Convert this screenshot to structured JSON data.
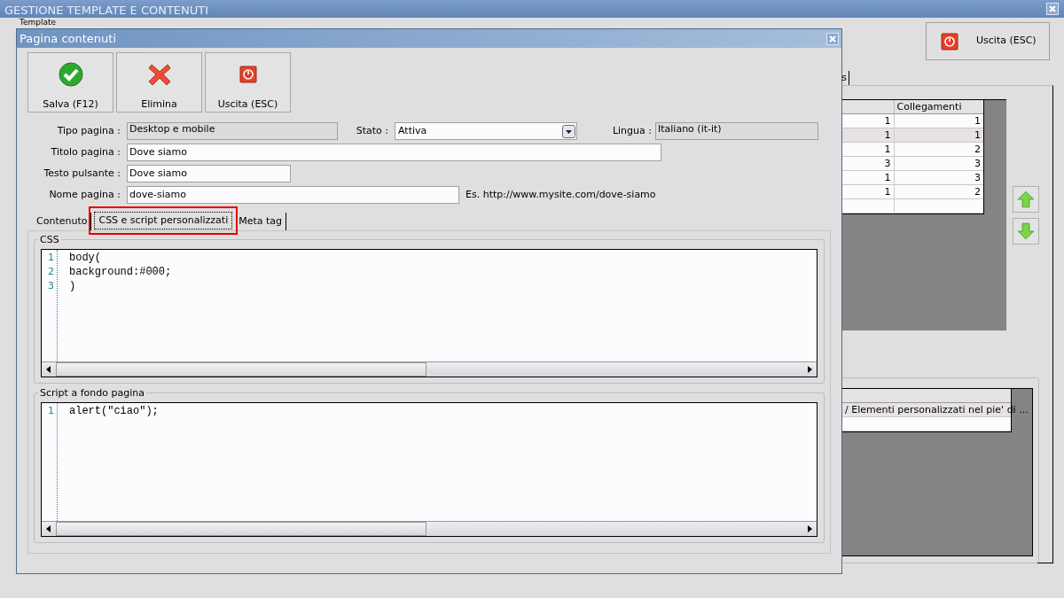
{
  "main_window": {
    "title": "GESTIONE TEMPLATE E CONTENUTI",
    "group_label": "Template",
    "exit_button": "Uscita (ESC)",
    "tab_fragment": "s",
    "links_table": {
      "columns": [
        "",
        "Collegamenti"
      ],
      "rows": [
        {
          "cells": [
            "1",
            "1"
          ],
          "selected": false
        },
        {
          "cells": [
            "1",
            "1"
          ],
          "selected": true
        },
        {
          "cells": [
            "1",
            "2"
          ],
          "selected": false
        },
        {
          "cells": [
            "3",
            "3"
          ],
          "selected": false
        },
        {
          "cells": [
            "1",
            "3"
          ],
          "selected": false
        },
        {
          "cells": [
            "1",
            "2"
          ],
          "selected": false
        },
        {
          "cells": [
            "",
            ""
          ],
          "selected": false
        }
      ]
    },
    "footer_table": {
      "rows": [
        "/ Elementi personalizzati nel pie' di ...",
        ""
      ]
    }
  },
  "dialog": {
    "title": "Pagina contenuti",
    "toolbar": [
      {
        "kind": "save",
        "label": "Salva (F12)"
      },
      {
        "kind": "delete",
        "label": "Elimina"
      },
      {
        "kind": "exit",
        "label": "Uscita (ESC)"
      }
    ],
    "fields": {
      "page_type": {
        "label": "Tipo pagina :",
        "value": "Desktop e mobile"
      },
      "state": {
        "label": "Stato :",
        "value": "Attiva"
      },
      "language": {
        "label": "Lingua :",
        "value": "Italiano (it-it)"
      },
      "page_title": {
        "label": "Titolo pagina :",
        "value": "Dove siamo"
      },
      "button_text": {
        "label": "Testo pulsante :",
        "value": "Dove siamo"
      },
      "page_name": {
        "label": "Nome pagina :",
        "value": "dove-siamo",
        "hint": "Es. http://www.mysite.com/dove-siamo"
      }
    },
    "tabs": [
      {
        "label": "Contenuto",
        "selected": false,
        "highlighted": false
      },
      {
        "label": "CSS e script personalizzati",
        "selected": true,
        "highlighted": true
      },
      {
        "label": "Meta tag",
        "selected": false,
        "highlighted": false
      }
    ],
    "css_group": {
      "title": "CSS",
      "lines": [
        {
          "number": "1",
          "text": "body("
        },
        {
          "number": "2",
          "text": "background:#000;"
        },
        {
          "number": "3",
          "text": ")"
        }
      ]
    },
    "script_group": {
      "title": "Script a fondo pagina",
      "lines": [
        {
          "number": "1",
          "text": "alert(\"ciao\");"
        }
      ]
    }
  }
}
